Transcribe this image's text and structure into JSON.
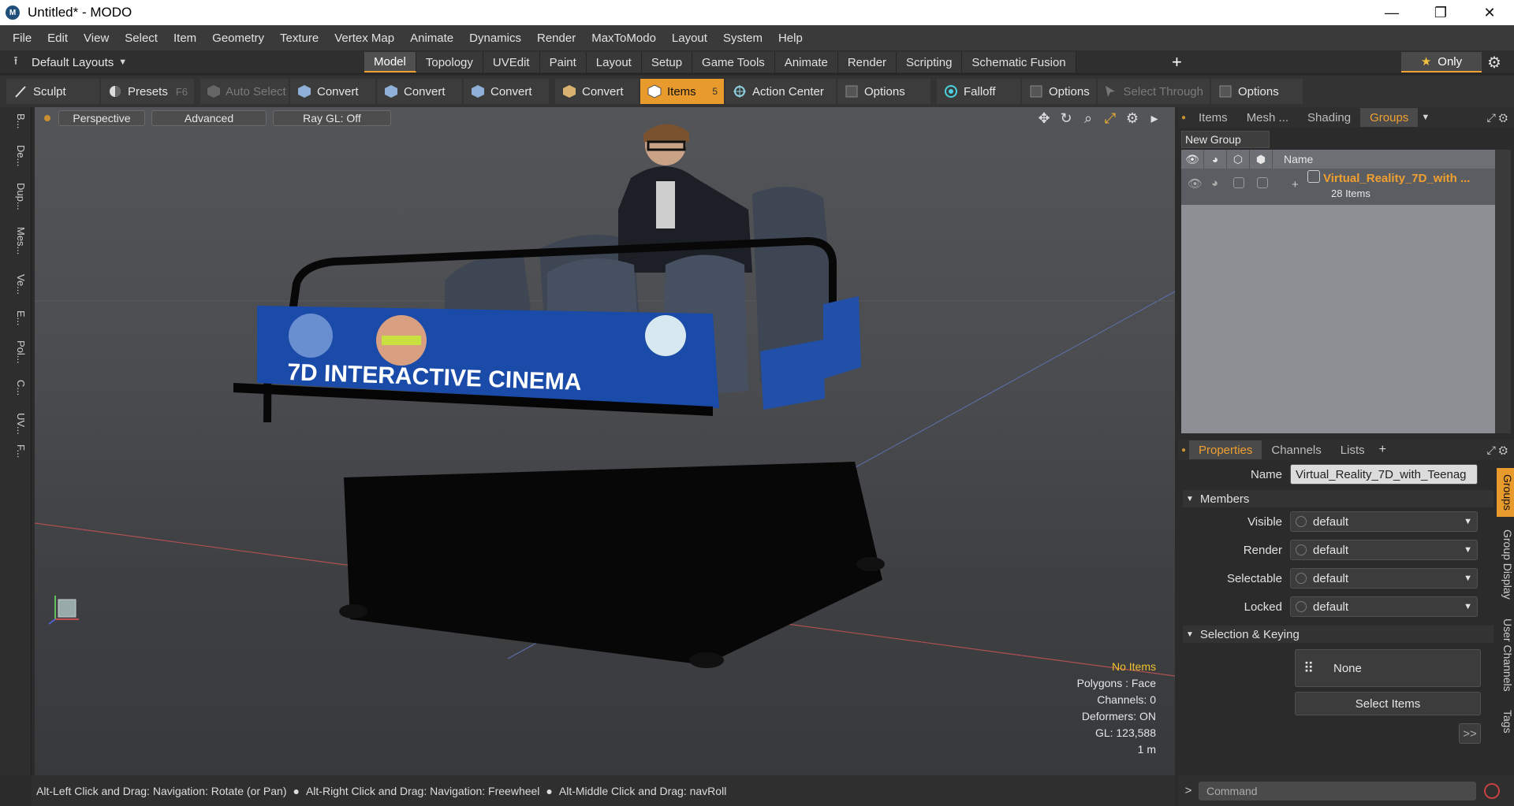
{
  "window": {
    "title": "Untitled* - MODO",
    "app_icon": "modo-logo-icon",
    "minimize": "—",
    "maximize": "❐",
    "close": "✕"
  },
  "menu": [
    "File",
    "Edit",
    "View",
    "Select",
    "Item",
    "Geometry",
    "Texture",
    "Vertex Map",
    "Animate",
    "Dynamics",
    "Render",
    "MaxToModo",
    "Layout",
    "System",
    "Help"
  ],
  "layout_tabs": {
    "layout_select": "Default Layouts",
    "tabs": [
      "Model",
      "Topology",
      "UVEdit",
      "Paint",
      "Layout",
      "Setup",
      "Game Tools",
      "Animate",
      "Render",
      "Scripting",
      "Schematic Fusion"
    ],
    "active": "Model",
    "add": "+",
    "only": "Only"
  },
  "toolbar": {
    "sculpt": "Sculpt",
    "presets": "Presets",
    "presets_hotkey": "F6",
    "auto_select": "Auto Select",
    "convert": "Convert",
    "items": "Items",
    "items_count": "5",
    "action_center": "Action Center",
    "options": "Options",
    "falloff": "Falloff",
    "select_through": "Select Through"
  },
  "left_tabs": [
    "B...",
    "De...",
    "Dup...",
    "Mes...",
    "Ve...",
    "E...",
    "Pol...",
    "C...",
    "UV...",
    "F..."
  ],
  "viewport": {
    "view": "Perspective",
    "shading": "Advanced",
    "raygl": "Ray GL: Off",
    "banner_text": "7D INTERACTIVE CINEMA",
    "stats": {
      "selection": "No Items",
      "polygons": "Polygons : Face",
      "channels": "Channels: 0",
      "deformers": "Deformers: ON",
      "gl": "GL: 123,588",
      "scale": "1 m"
    }
  },
  "status": {
    "hint1": "Alt-Left Click and Drag: Navigation: Rotate (or Pan)",
    "hint2": "Alt-Right Click and Drag: Navigation: Freewheel",
    "hint3": "Alt-Middle Click and Drag: navRoll"
  },
  "top_panel": {
    "tabs": [
      "Items",
      "Mesh ...",
      "Shading",
      "Groups"
    ],
    "active": "Groups",
    "new_group": "New Group",
    "column_name": "Name",
    "group": {
      "name": "Virtual_Reality_7D_with ...",
      "count": "28 Items"
    }
  },
  "properties": {
    "tabs": [
      "Properties",
      "Channels",
      "Lists"
    ],
    "active": "Properties",
    "name_label": "Name",
    "name_value": "Virtual_Reality_7D_with_Teenag",
    "members_section": "Members",
    "rows": [
      {
        "label": "Visible",
        "value": "default"
      },
      {
        "label": "Render",
        "value": "default"
      },
      {
        "label": "Selectable",
        "value": "default"
      },
      {
        "label": "Locked",
        "value": "default"
      }
    ],
    "sel_section": "Selection & Keying",
    "none_btn": "None",
    "select_items_btn": "Select Items",
    "more": ">>",
    "side_tabs": [
      "Groups",
      "Group Display",
      "User Channels",
      "Tags"
    ]
  },
  "command": {
    "prompt": ">",
    "placeholder": "Command"
  },
  "colors": {
    "accent": "#f0a030",
    "group_name": "#f0a030",
    "stats_highlight": "#f0c030"
  }
}
